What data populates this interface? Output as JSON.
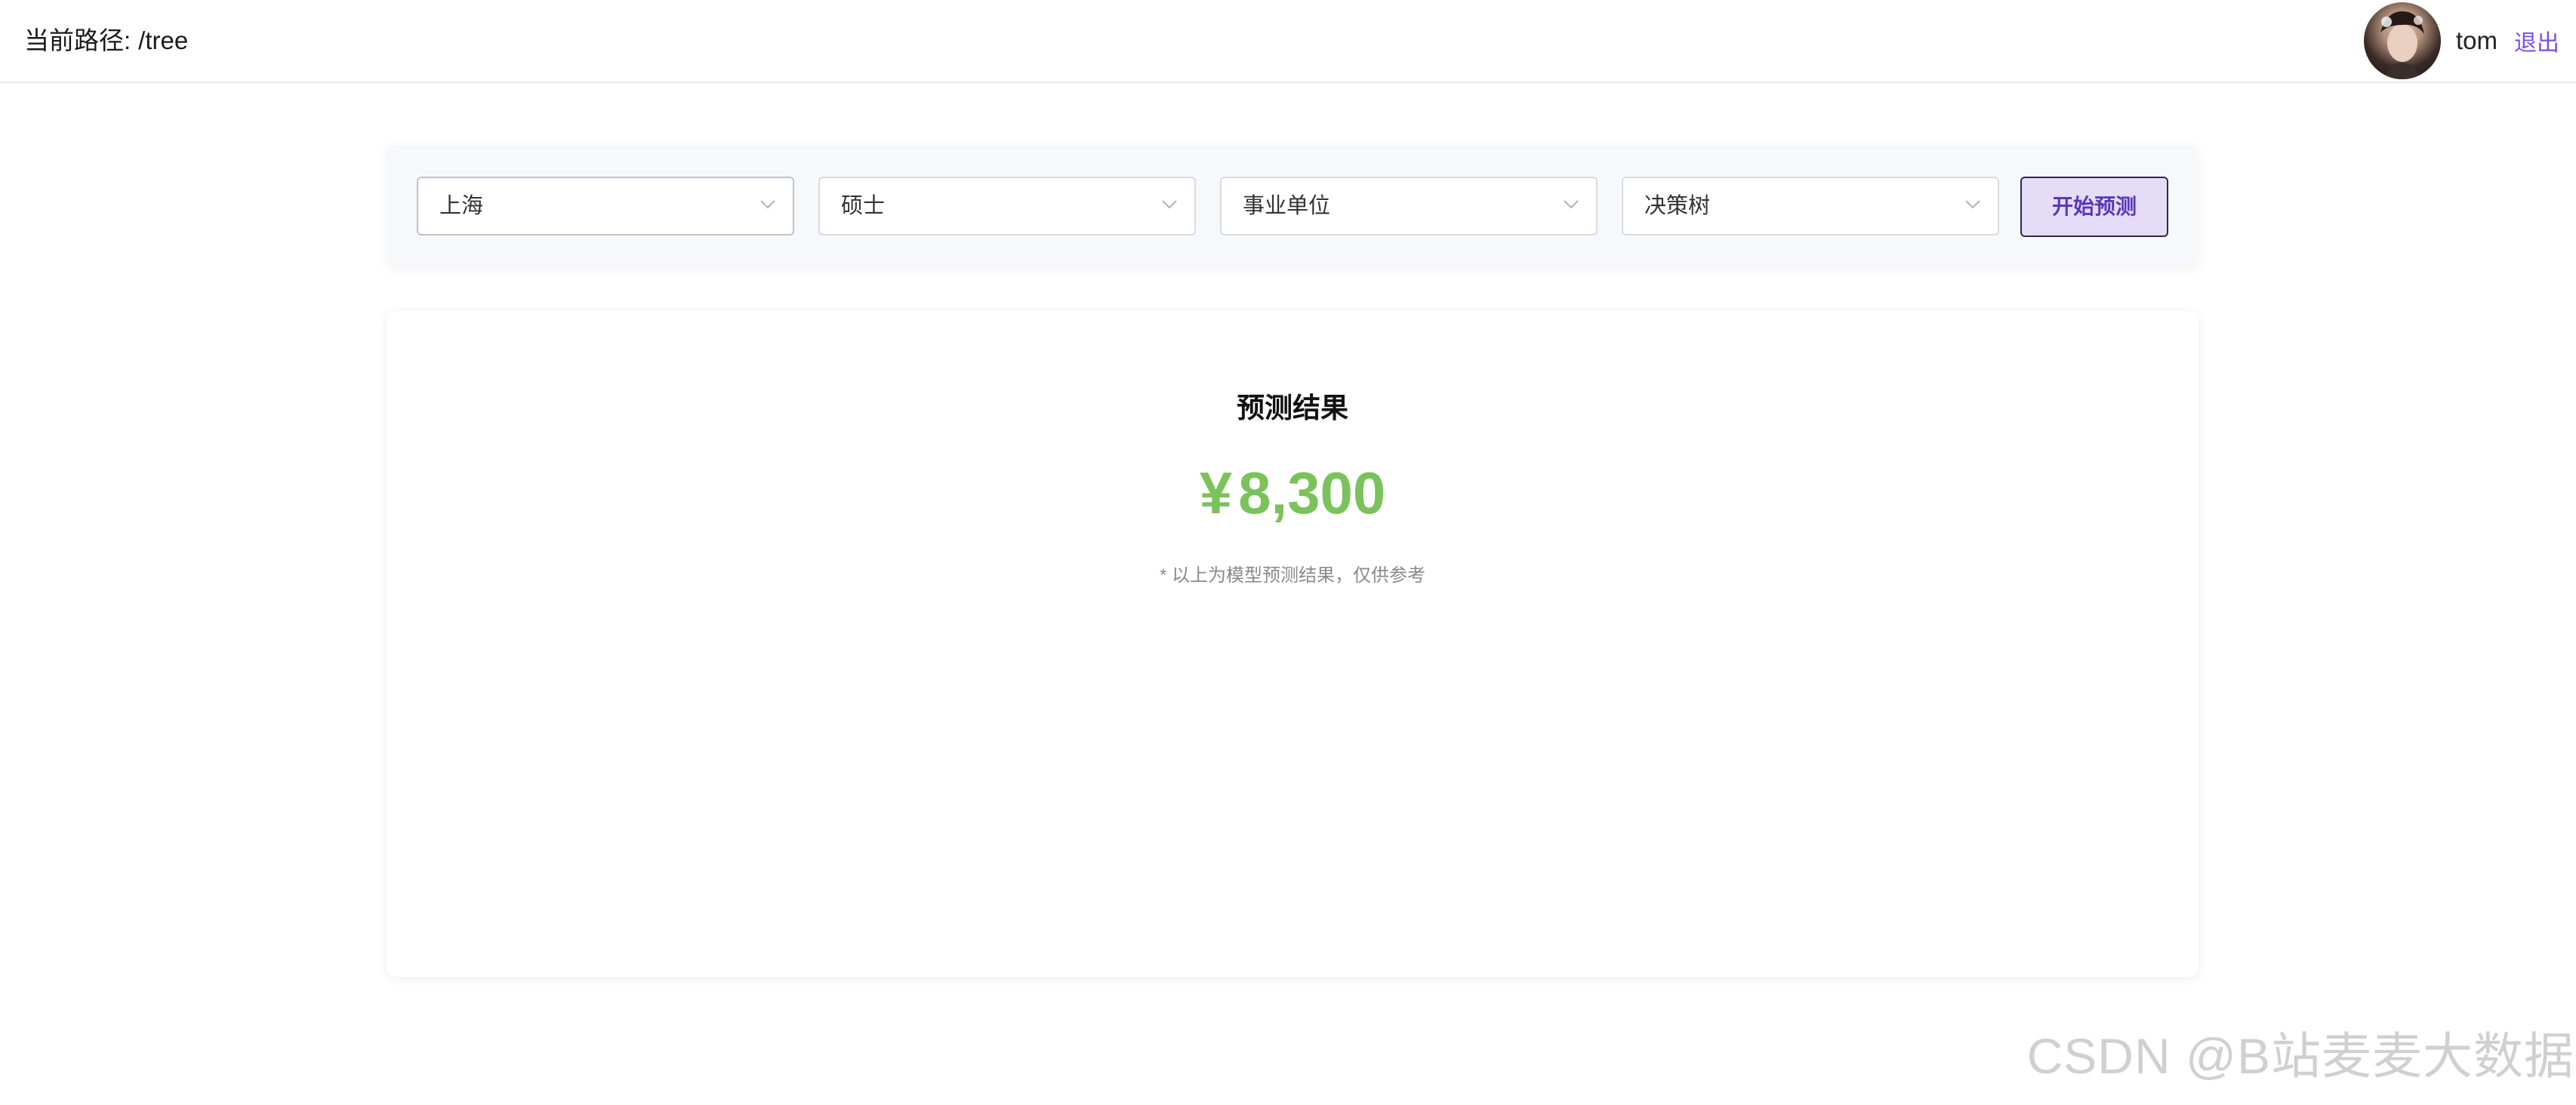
{
  "header": {
    "path_label": "当前路径:",
    "path_value": "/tree",
    "username": "tom",
    "logout_label": "退出"
  },
  "filters": {
    "city": "上海",
    "education": "硕士",
    "company_type": "事业单位",
    "model": "决策树",
    "predict_label": "开始预测"
  },
  "result": {
    "title": "预测结果",
    "currency": "¥",
    "amount": "8,300",
    "note": "* 以上为模型预测结果，仅供参考"
  },
  "watermark": "CSDN @B站麦麦大数据",
  "colors": {
    "accent": "#7a4fe0",
    "button_bg": "#e5dcf8",
    "amount": "#7bc25a"
  }
}
